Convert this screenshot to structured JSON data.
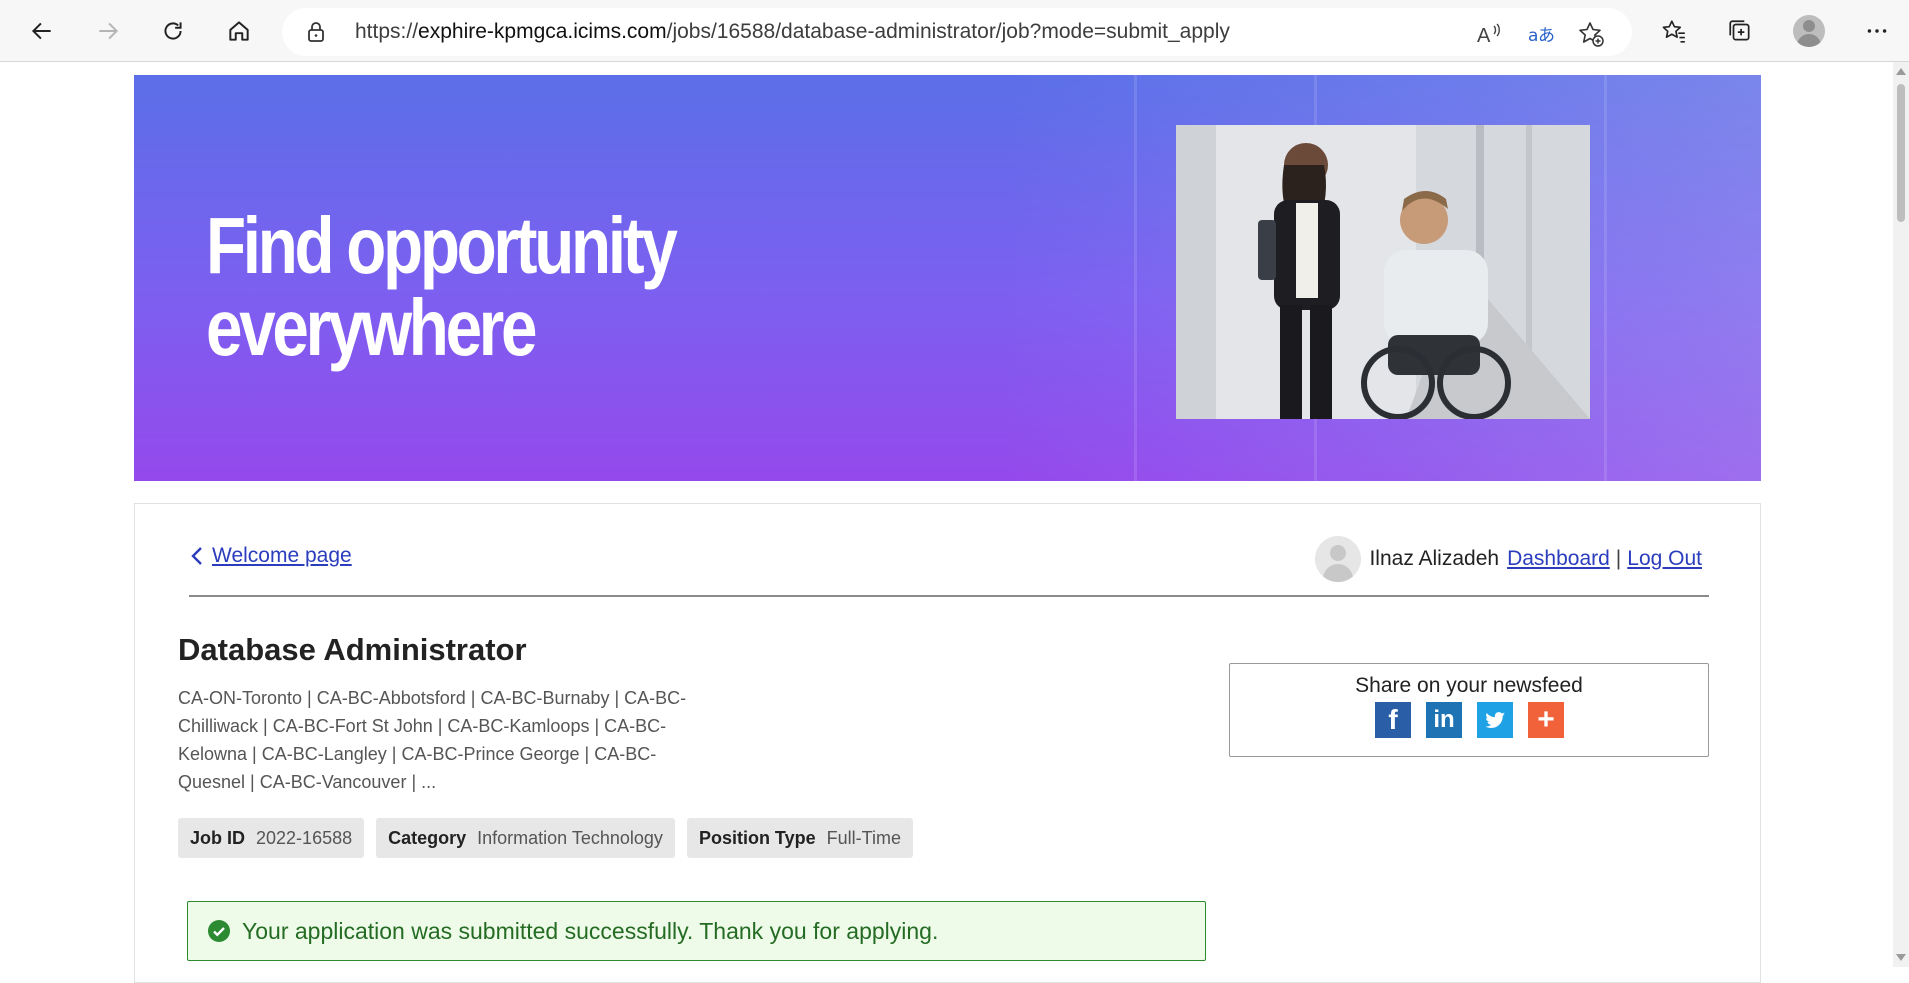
{
  "browser": {
    "url_prefix": "https://",
    "url_domain": "exphire-kpmgca.icims.com",
    "url_path": "/jobs/16588/database-administrator/job?mode=submit_apply"
  },
  "banner": {
    "headline_line1": "Find opportunity",
    "headline_line2": "everywhere"
  },
  "nav": {
    "back_label": "Welcome page",
    "user_name": "Ilnaz Alizadeh",
    "dashboard_label": "Dashboard",
    "separator": "|",
    "logout_label": "Log Out"
  },
  "job": {
    "title": "Database Administrator",
    "locations": "CA-ON-Toronto | CA-BC-Abbotsford | CA-BC-Burnaby | CA-BC-Chilliwack | CA-BC-Fort St John | CA-BC-Kamloops | CA-BC-Kelowna | CA-BC-Langley | CA-BC-Prince George | CA-BC-Quesnel | CA-BC-Vancouver | ...",
    "tags": [
      {
        "label": "Job ID",
        "value": "2022-16588"
      },
      {
        "label": "Category",
        "value": "Information Technology"
      },
      {
        "label": "Position Type",
        "value": "Full-Time"
      }
    ]
  },
  "share": {
    "title": "Share on your newsfeed",
    "icons": [
      "facebook-icon",
      "linkedin-icon",
      "twitter-icon",
      "addthis-plus-icon"
    ]
  },
  "alert": {
    "message": "Your application was submitted successfully. Thank you for applying."
  },
  "colors": {
    "link": "#2b3dbd",
    "banner_top": "#5b6fe8",
    "banner_bottom": "#9449ec",
    "success_border": "#2d8b2d",
    "success_bg": "#eefbe8"
  }
}
